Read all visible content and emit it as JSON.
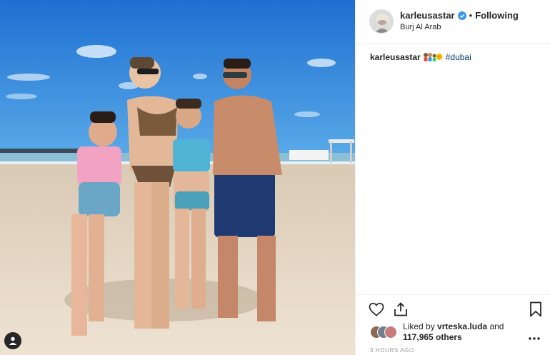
{
  "photo": {
    "user_tag_icon": "person-icon"
  },
  "post": {
    "username": "karleusastar",
    "verified_icon": "verified-badge-icon",
    "separator": "•",
    "follow_status": "Following",
    "location": "Burj Al Arab"
  },
  "caption": {
    "username": "karleusastar",
    "emoji": "family-emoji sun-emoji",
    "hashtag": "#dubai"
  },
  "actions": {
    "like_icon": "heart-icon",
    "share_icon": "share-icon",
    "save_icon": "bookmark-icon"
  },
  "likes": {
    "prefix": "Liked by",
    "liker": "vrteska.luda",
    "joiner": "and",
    "count": "117,965 others"
  },
  "timestamp": "3 HOURS AGO",
  "colors": {
    "verified": "#3897f0",
    "text": "#262626",
    "hashtag": "#003569",
    "muted": "#999999"
  }
}
